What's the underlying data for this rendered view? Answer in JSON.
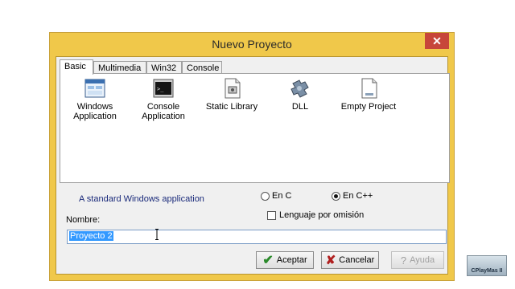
{
  "dialog": {
    "title": "Nuevo Proyecto",
    "close_glyph": "✕"
  },
  "tabs": [
    {
      "label": "Basic"
    },
    {
      "label": "Multimedia"
    },
    {
      "label": "Win32"
    },
    {
      "label": "Console"
    }
  ],
  "templates": [
    {
      "label1": "Windows",
      "label2": "Application",
      "icon": "windows-app-icon"
    },
    {
      "label1": "Console",
      "label2": "Application",
      "icon": "console-app-icon"
    },
    {
      "label1": "Static Library",
      "label2": "",
      "icon": "static-library-icon"
    },
    {
      "label1": "DLL",
      "label2": "",
      "icon": "dll-icon"
    },
    {
      "label1": "Empty Project",
      "label2": "",
      "icon": "empty-project-icon"
    }
  ],
  "description": "A standard Windows application",
  "language": {
    "c_label": "En C",
    "cpp_label": "En C++",
    "selected": "cpp"
  },
  "default_language_label": "Lenguaje por omisión",
  "name_field": {
    "label": "Nombre:",
    "value": "Proyecto 2"
  },
  "buttons": {
    "ok": "Aceptar",
    "cancel": "Cancelar",
    "help": "Ayuda"
  },
  "watermark": {
    "text": "CPlayMas II"
  },
  "colors": {
    "frame": "#f0c84a",
    "close": "#c7463a",
    "selection": "#3399ff"
  }
}
